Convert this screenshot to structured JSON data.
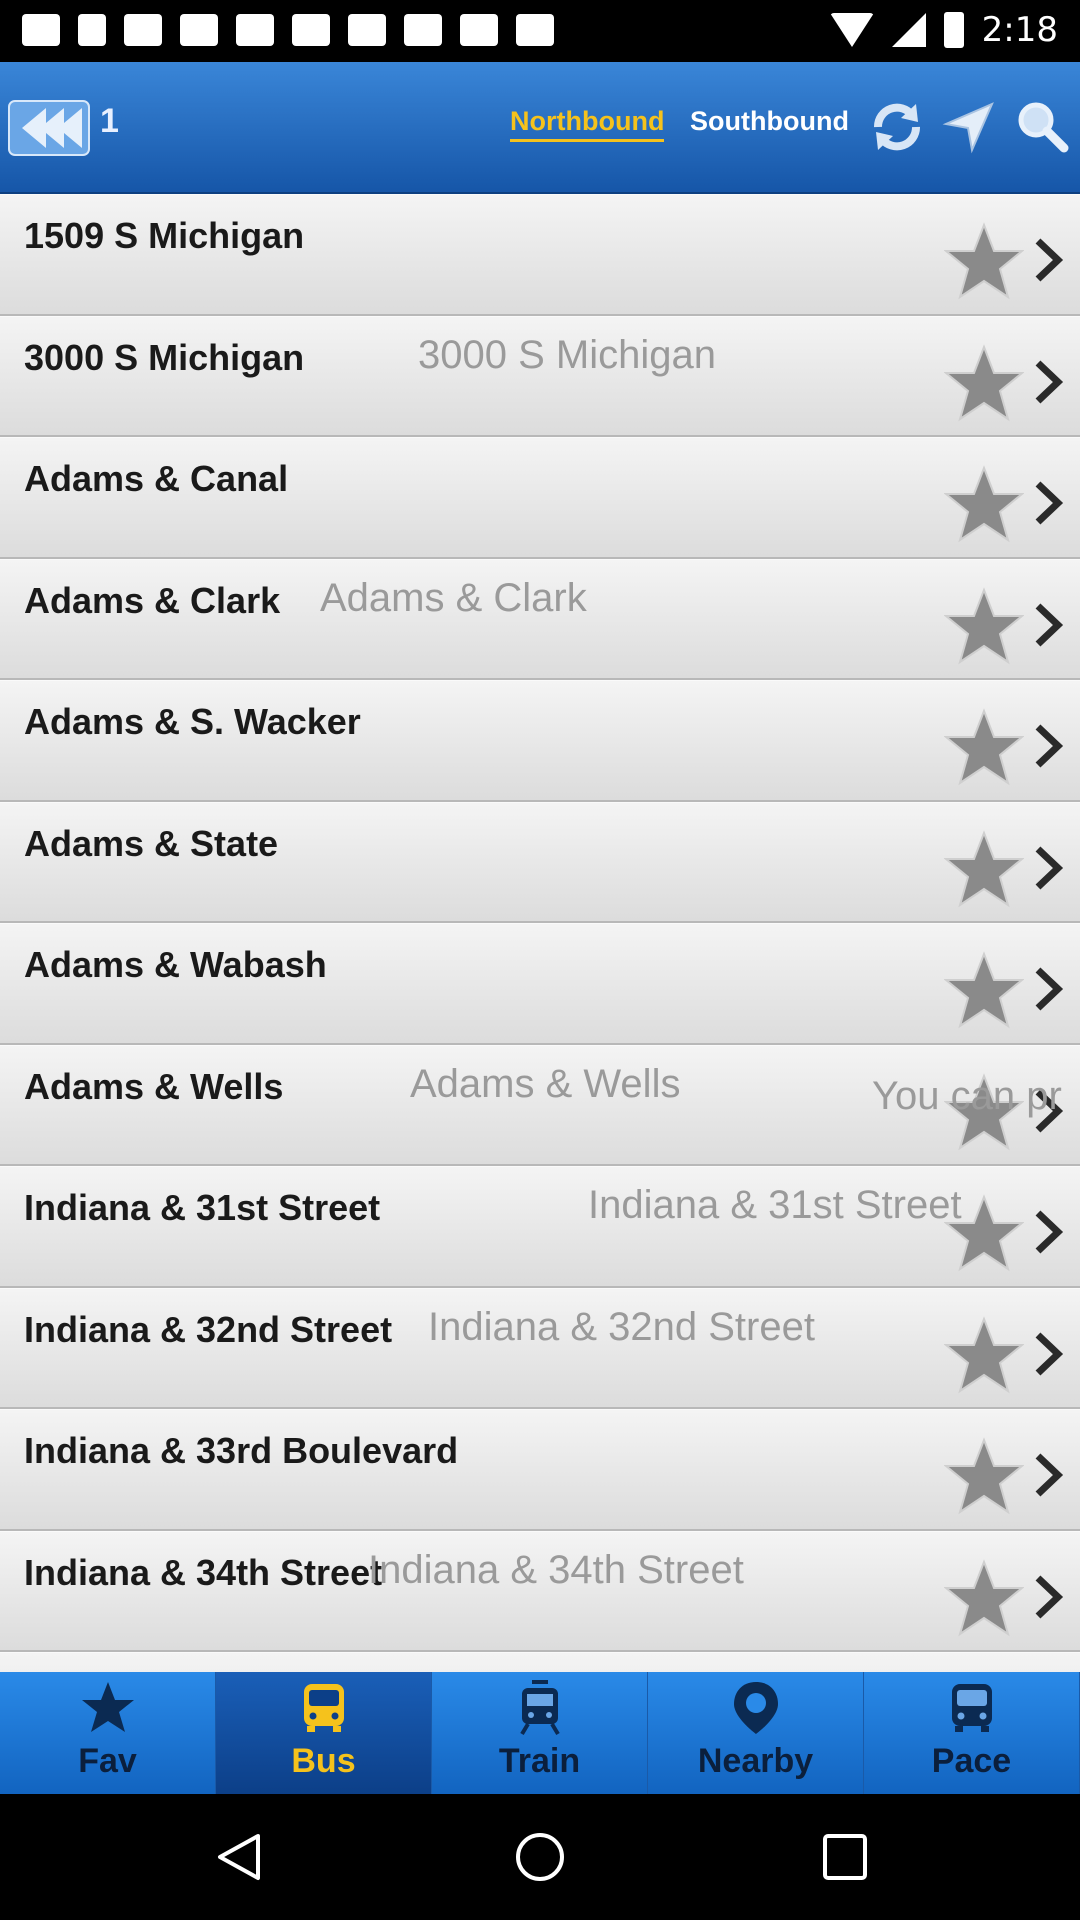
{
  "status_bar": {
    "time": "2:18"
  },
  "header": {
    "route_number": "1",
    "tabs": {
      "northbound": "Northbound",
      "southbound": "Southbound"
    },
    "active_tab": "northbound",
    "accent_color": "#f5c21c",
    "bar_color": "#1b6ec8"
  },
  "stops": [
    {
      "name": "1509 S Michigan",
      "ghost": ""
    },
    {
      "name": "3000 S Michigan",
      "ghost": "3000 S Michigan"
    },
    {
      "name": "Adams & Canal",
      "ghost": ""
    },
    {
      "name": "Adams & Clark",
      "ghost": "Adams & Clark"
    },
    {
      "name": "Adams & S. Wacker",
      "ghost": ""
    },
    {
      "name": "Adams & State",
      "ghost": ""
    },
    {
      "name": "Adams & Wabash",
      "ghost": ""
    },
    {
      "name": "Adams & Wells",
      "ghost": "Adams & Wells"
    },
    {
      "name": "Indiana & 31st Street",
      "ghost": "Indiana & 31st Street"
    },
    {
      "name": "Indiana & 32nd Street",
      "ghost": "Indiana & 32nd Street"
    },
    {
      "name": "Indiana & 33rd Boulevard",
      "ghost": ""
    },
    {
      "name": "Indiana & 34th Street",
      "ghost": "Indiana & 34th Street"
    }
  ],
  "overlay_hint": "You can pr",
  "bottom_tabs": [
    {
      "label": "Fav",
      "icon": "star-icon"
    },
    {
      "label": "Bus",
      "icon": "bus-icon"
    },
    {
      "label": "Train",
      "icon": "train-icon"
    },
    {
      "label": "Nearby",
      "icon": "map-pin-icon"
    },
    {
      "label": "Pace",
      "icon": "pace-bus-icon"
    }
  ],
  "active_bottom_tab": "Bus"
}
